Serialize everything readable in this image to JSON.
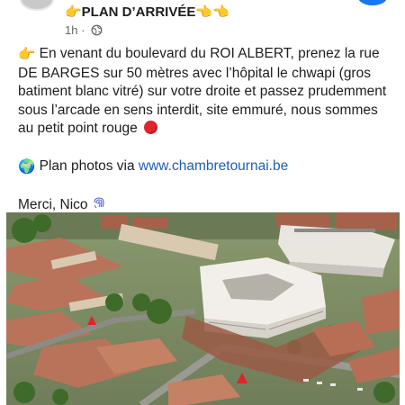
{
  "post": {
    "title": "👉PLAN D’ARRIVÉE👈👈",
    "time": "1h ·",
    "paragraph1_icon": "👉",
    "paragraph1": "En venant du boulevard du ROI ALBERT, prenez la rue DE BARGES sur 50 mètres avec l’hôpital le chwapi (gros batiment blanc vitré) sur votre droite et passez prudemment sous l’arcade en sens interdit, site emmuré, nous sommes au petit point rouge",
    "paragraph2_icon": "🌍",
    "paragraph2_prefix": "Plan photos via ",
    "paragraph2_link": "www.chambretournai.be",
    "signature": "Merci, Nico",
    "signature_icon": "fingerprint-icon"
  },
  "colors": {
    "link": "#1d5fb6",
    "red_dot": "#e0242b",
    "meta_text": "#65676b"
  }
}
